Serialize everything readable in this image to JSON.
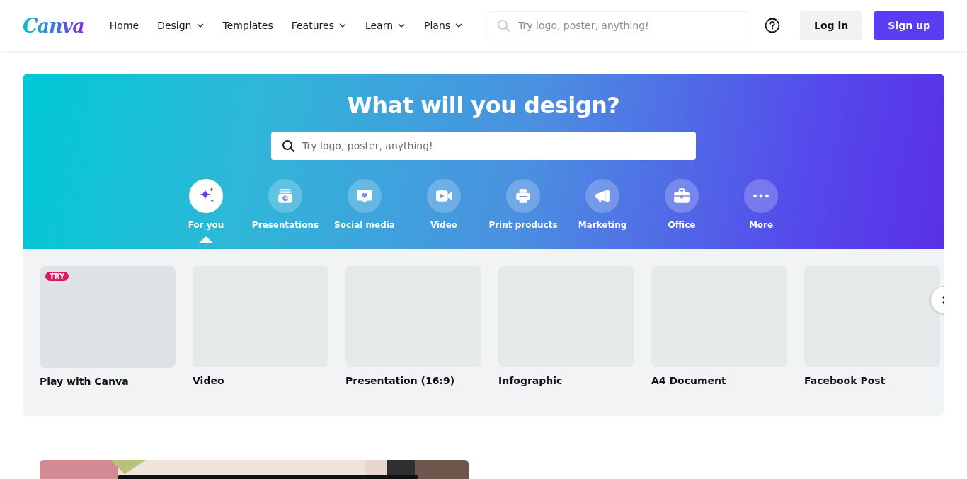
{
  "header": {
    "logo": "Canva",
    "nav": [
      {
        "label": "Home",
        "dropdown": false
      },
      {
        "label": "Design",
        "dropdown": true
      },
      {
        "label": "Templates",
        "dropdown": false
      },
      {
        "label": "Features",
        "dropdown": true
      },
      {
        "label": "Learn",
        "dropdown": true
      },
      {
        "label": "Plans",
        "dropdown": true
      }
    ],
    "search": {
      "placeholder": "Try logo, poster, anything!"
    },
    "buttons": [
      {
        "label": "Log in",
        "kind": "secondary"
      },
      {
        "label": "Sign up",
        "kind": "primary"
      }
    ]
  },
  "hero": {
    "title": "What will you design?",
    "search": {
      "placeholder": "Try logo, poster, anything!"
    },
    "categories": [
      {
        "label": "For you",
        "selected": true
      },
      {
        "label": "Presentations",
        "selected": false
      },
      {
        "label": "Social media",
        "selected": false
      },
      {
        "label": "Video",
        "selected": false
      },
      {
        "label": "Print products",
        "selected": false
      },
      {
        "label": "Marketing",
        "selected": false
      },
      {
        "label": "Office",
        "selected": false
      },
      {
        "label": "More",
        "selected": false
      }
    ]
  },
  "designs": [
    {
      "label": "Play with Canva",
      "badge": "TRY"
    },
    {
      "label": "Video"
    },
    {
      "label": "Presentation (16:9)"
    },
    {
      "label": "Infographic"
    },
    {
      "label": "A4 Document"
    },
    {
      "label": "Facebook Post"
    }
  ]
}
